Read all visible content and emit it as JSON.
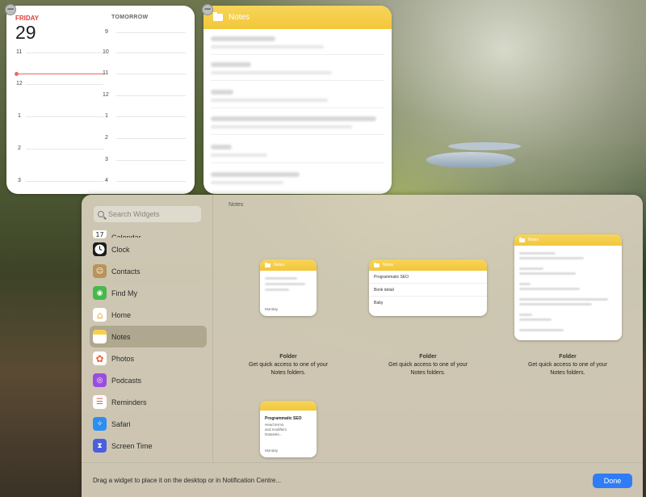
{
  "calendar": {
    "day_name": "FRIDAY",
    "day_number": "29",
    "tomorrow_label": "TOMORROW",
    "today_hours": [
      "11",
      "12",
      "1",
      "2",
      "3"
    ],
    "tomorrow_hours": [
      "9",
      "10",
      "11",
      "12",
      "1",
      "2",
      "3",
      "4"
    ]
  },
  "notes_widget": {
    "title": "Notes"
  },
  "gallery": {
    "search_placeholder": "Search Widgets",
    "section_title": "Notes",
    "sidebar": [
      {
        "label": "Calendar",
        "icon": "calendar-icon",
        "color": "#ffffff",
        "glyph": "17"
      },
      {
        "label": "Clock",
        "icon": "clock-icon",
        "color": "#1c1c1c",
        "glyph": "◷"
      },
      {
        "label": "Contacts",
        "icon": "contacts-icon",
        "color": "#b8935a",
        "glyph": "☺"
      },
      {
        "label": "Find My",
        "icon": "find-my-icon",
        "color": "#45b94a",
        "glyph": "◉"
      },
      {
        "label": "Home",
        "icon": "home-icon",
        "color": "#f4a53a",
        "glyph": "⌂"
      },
      {
        "label": "Notes",
        "icon": "notes-icon",
        "color": "#f6d14b",
        "glyph": "≡"
      },
      {
        "label": "Photos",
        "icon": "photos-icon",
        "color": "#ffffff",
        "glyph": "✿"
      },
      {
        "label": "Podcasts",
        "icon": "podcasts-icon",
        "color": "#9b4ce0",
        "glyph": "◎"
      },
      {
        "label": "Reminders",
        "icon": "reminders-icon",
        "color": "#ffffff",
        "glyph": "☰"
      },
      {
        "label": "Safari",
        "icon": "safari-icon",
        "color": "#2d8ef0",
        "glyph": "✧"
      },
      {
        "label": "Screen Time",
        "icon": "screen-time-icon",
        "color": "#4a5fe0",
        "glyph": "⧗"
      }
    ],
    "previews": {
      "small": {
        "bar_title": "Notes",
        "footer": "Monday"
      },
      "medium": {
        "bar_title": "Notes",
        "rows": [
          "Programmatic SEO",
          "Bonk detail",
          "Baby"
        ]
      },
      "large": {
        "bar_title": "Notes"
      },
      "note": {
        "title": "Programmatic SEO",
        "snippet_lines": [
          "Head terms",
          "and modifiers",
          "Datasets..."
        ],
        "footer": "Monday"
      }
    },
    "captions": [
      {
        "name": "Folder",
        "desc_line1": "Get quick access to one of your",
        "desc_line2": "Notes folders."
      },
      {
        "name": "Folder",
        "desc_line1": "Get quick access to one of your",
        "desc_line2": "Notes folders."
      },
      {
        "name": "Folder",
        "desc_line1": "Get quick access to one of your",
        "desc_line2": "Notes folders."
      }
    ],
    "hint": "Drag a widget to place it on the desktop or in Notification Centre...",
    "done_label": "Done"
  },
  "colors": {
    "accent": "#2f7cf6",
    "notes_yellow": "#f2c73a",
    "calendar_red": "#e0413a"
  }
}
